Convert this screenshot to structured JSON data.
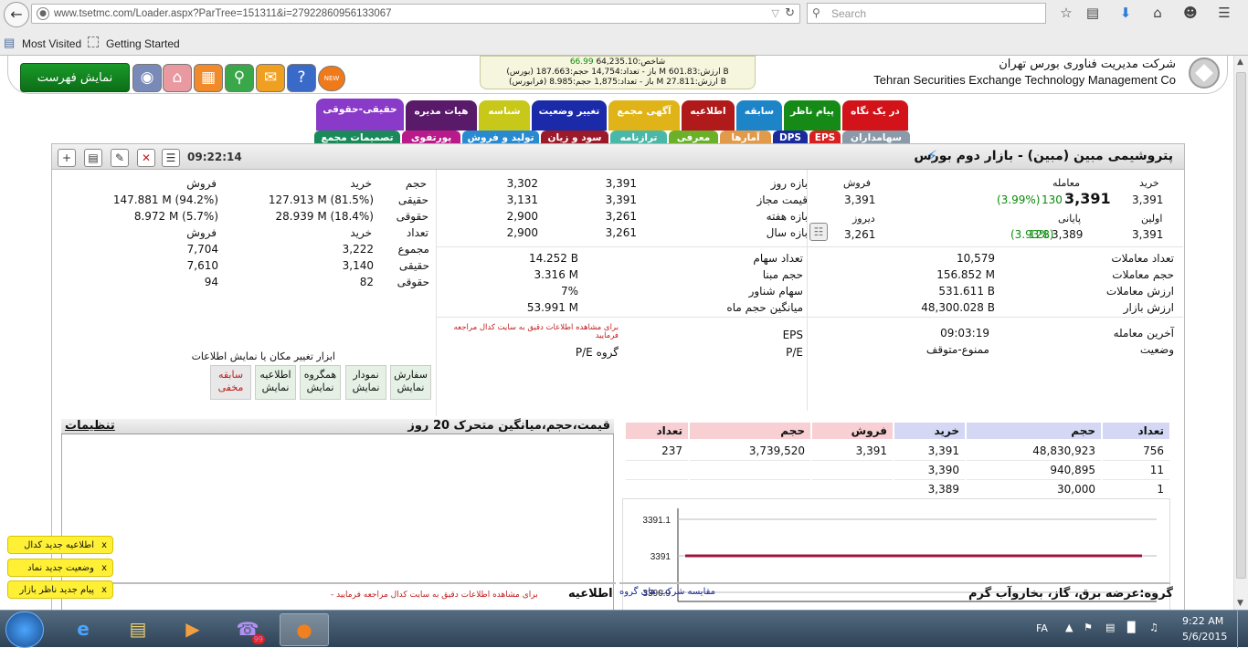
{
  "browser": {
    "url": "www.tsetmc.com/Loader.aspx?ParTree=151311&i=27922860956133067",
    "search_placeholder": "Search",
    "bookmarks": [
      "Most Visited",
      "Getting Started"
    ]
  },
  "header": {
    "company_fa": "شرکت مدیریت فناوری بورس تهران",
    "company_en": "Tehran Securities Exchange Technology Management Co",
    "show_list": "نمایش فهرست",
    "index_line1_label": "شاخص:",
    "index_line1_value": "64,235.10",
    "index_line1_change": "66.99",
    "index_line2": "(بورس) باز - تعداد:14,754 حجم:187.663 M ارزش:601.83 B",
    "index_line3": "(فرابورس) باز - تعداد:1,875 حجم:8.985 M ارزش:27.811 B",
    "new_badge": "NEW"
  },
  "tabs_row1": [
    {
      "label": "در یک نگاه",
      "color": "#d2141a"
    },
    {
      "label": "پیام ناظر",
      "color": "#168a16"
    },
    {
      "label": "سابقه",
      "color": "#1e84c8"
    },
    {
      "label": "اطلاعیه",
      "color": "#b01a1a"
    },
    {
      "label": "آگهی مجمع",
      "color": "#e0b418"
    },
    {
      "label": "تغییر وضعیت",
      "color": "#1a2aa8"
    },
    {
      "label": "شناسه",
      "color": "#c8c81a"
    },
    {
      "label": "هیات مدیره",
      "color": "#5a1a6a"
    },
    {
      "label": "حقیقی-حقوقی",
      "color": "#8a3ac8"
    }
  ],
  "tabs_row2": [
    {
      "label": "سهامداران",
      "color": "#8a9aa8"
    },
    {
      "label": "EPS",
      "color": "#d82020"
    },
    {
      "label": "DPS",
      "color": "#1a2a9a"
    },
    {
      "label": "آمارها",
      "color": "#e09a4a"
    },
    {
      "label": "معرفی",
      "color": "#6ab028"
    },
    {
      "label": "ترازنامه",
      "color": "#4ab8a8"
    },
    {
      "label": "سود و زیان",
      "color": "#9a1a2a"
    },
    {
      "label": "تولید و فروش",
      "color": "#2a8ad0"
    },
    {
      "label": "پورتفوی",
      "color": "#b81a8a"
    },
    {
      "label": "تصمیمات مجمع",
      "color": "#1a8a5a"
    }
  ],
  "stock": {
    "title": "پتروشیمی مبین (مبین) - بازار دوم بورس",
    "time": "09:22:14",
    "buy_label": "خرید",
    "trade_label": "معامله",
    "sell_label": "فروش",
    "buy_value": "3,391",
    "last_trade": "3,391",
    "last_change": "130",
    "last_pct": "(3.99%)",
    "sell_value": "3,391",
    "first_label": "اولین",
    "first_value": "3,391",
    "close_label": "پایانی",
    "close_value": "3,389",
    "close_change": "128",
    "close_pct": "(3.93%)",
    "yesterday_label": "دیروز",
    "yesterday_value": "3,261",
    "ranges": [
      {
        "label": "بازه روز",
        "hi": "3,391",
        "lo": "3,302"
      },
      {
        "label": "قیمت مجاز",
        "hi": "3,391",
        "lo": "3,131"
      },
      {
        "label": "بازه هفته",
        "hi": "3,261",
        "lo": "2,900"
      },
      {
        "label": "بازه سال",
        "hi": "3,261",
        "lo": "2,900"
      }
    ],
    "stats_left": [
      {
        "label": "تعداد معاملات",
        "value": "10,579"
      },
      {
        "label": "حجم معاملات",
        "value": "156.852 M"
      },
      {
        "label": "ارزش معاملات",
        "value": "531.611 B"
      },
      {
        "label": "ارزش بازار",
        "value": "48,300.028 B"
      }
    ],
    "stats_mid": [
      {
        "label": "تعداد سهام",
        "value": "14.252 B"
      },
      {
        "label": "حجم مبنا",
        "value": "3.316 M"
      },
      {
        "label": "سهام شناور",
        "value": "7%"
      },
      {
        "label": "میانگین حجم ماه",
        "value": "53.991 M"
      }
    ],
    "last_trade_label": "آخرین معامله",
    "last_trade_time": "09:03:19",
    "status_label": "وضعیت",
    "status_value": "ممنوع-متوقف",
    "eps_label": "EPS",
    "pe_label": "P/E",
    "group_pe_label": "P/E گروه",
    "red_note": "برای مشاهده اطلاعات دقیق به سایت کدال مراجعه فرمایید"
  },
  "real_legal": {
    "h_volume": "حجم",
    "h_buy": "خرید",
    "h_sell": "فروش",
    "real_label": "حقیقی",
    "legal_label": "حقوقی",
    "real_buy": "127.913 M (81.5%)",
    "real_sell": "147.881 M (94.2%)",
    "legal_buy": "28.939 M (18.4%)",
    "legal_sell": "8.972 M (5.7%)",
    "h_count": "تعداد",
    "total_label": "مجموع",
    "count_buy_total": "3,222",
    "count_sell_total": "7,704",
    "count_buy_real": "3,140",
    "count_sell_real": "7,610",
    "count_buy_legal": "82",
    "count_sell_legal": "94"
  },
  "tools": {
    "title": "ابزار تغییر مکان یا نمایش اطلاعات",
    "buttons": [
      {
        "name": "سفارش",
        "state": "نمایش"
      },
      {
        "name": "نمودار",
        "state": "نمایش"
      },
      {
        "name": "همگروه",
        "state": "نمایش"
      },
      {
        "name": "اطلاعیه",
        "state": "نمایش"
      },
      {
        "name": "سابقه",
        "state": "مخفی"
      }
    ]
  },
  "chart_section": {
    "title": "قیمت،حجم،میانگین متحرک 20 روز",
    "settings": "تنظیمات"
  },
  "orderbook": {
    "headers": [
      "تعداد",
      "حجم",
      "خرید",
      "فروش",
      "حجم",
      "تعداد"
    ],
    "rows": [
      {
        "buy_count": "756",
        "buy_vol": "48,830,923",
        "buy_price": "3,391",
        "sell_price": "3,391",
        "sell_vol": "3,739,520",
        "sell_count": "237"
      },
      {
        "buy_count": "11",
        "buy_vol": "940,895",
        "buy_price": "3,390",
        "sell_price": "",
        "sell_vol": "",
        "sell_count": ""
      },
      {
        "buy_count": "1",
        "buy_vol": "30,000",
        "buy_price": "3,389",
        "sell_price": "",
        "sell_vol": "",
        "sell_count": ""
      }
    ]
  },
  "chart_data": {
    "type": "line",
    "x": [
      0,
      1
    ],
    "series": [
      {
        "values": [
          3391,
          3391
        ]
      }
    ],
    "yticks": [
      "3391.1",
      "3391",
      "3390.9"
    ],
    "ylim": [
      3390.9,
      3391.1
    ],
    "line_color": "#a0143c"
  },
  "bottom": {
    "group": "گروه:عرضه برق، گاز، بخاروآب گرم",
    "compare": "مقایسه شرکت های گروه",
    "announce": "اطلاعیه",
    "announce_note": "- برای مشاهده اطلاعات دقیق به سایت کدال مراجعه فرمایید"
  },
  "notifications": [
    "اطلاعیه جدید کدال",
    "وضعیت جدید نماد",
    "پیام جدید ناظر بازار"
  ],
  "taskbar": {
    "lang": "FA",
    "time": "9:22 AM",
    "date": "5/6/2015",
    "viber_badge": "99"
  }
}
